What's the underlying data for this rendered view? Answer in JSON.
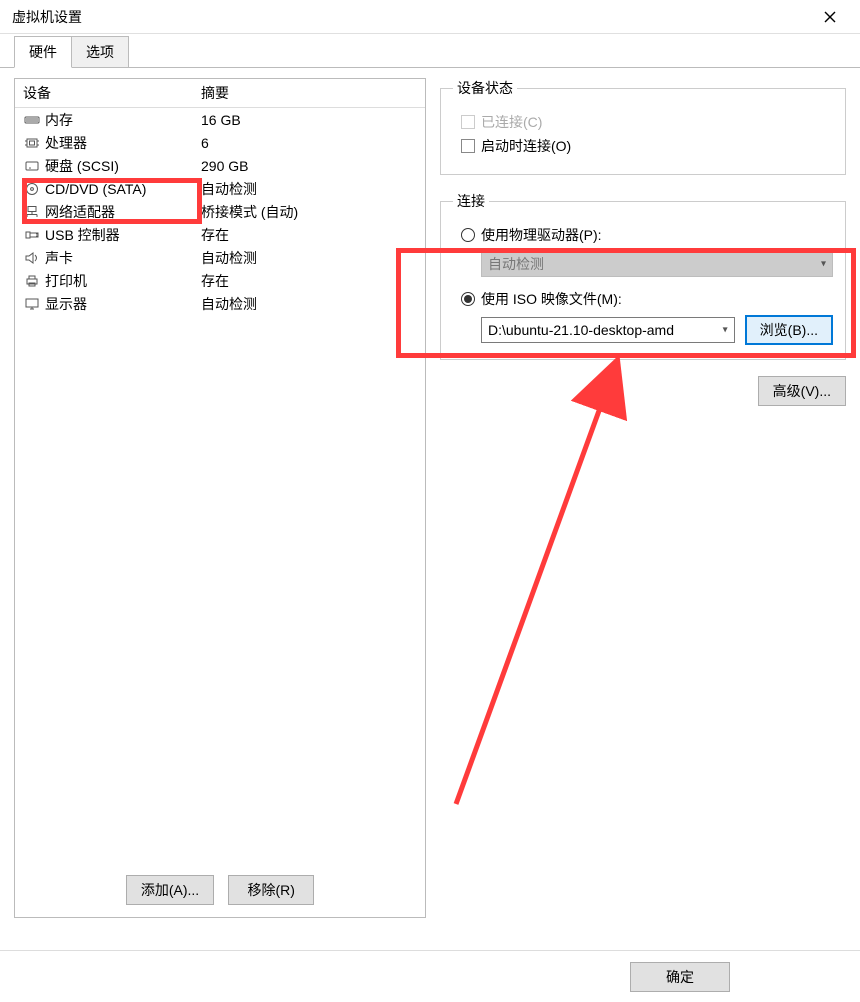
{
  "title": "虚拟机设置",
  "tabs": {
    "hardware": "硬件",
    "options": "选项"
  },
  "headers": {
    "device": "设备",
    "summary": "摘要"
  },
  "devices": [
    {
      "name": "内存",
      "summary": "16 GB",
      "icon": "memory"
    },
    {
      "name": "处理器",
      "summary": "6",
      "icon": "cpu"
    },
    {
      "name": "硬盘 (SCSI)",
      "summary": "290 GB",
      "icon": "disk"
    },
    {
      "name": "CD/DVD (SATA)",
      "summary": "自动检测",
      "icon": "cd"
    },
    {
      "name": "网络适配器",
      "summary": "桥接模式 (自动)",
      "icon": "net"
    },
    {
      "name": "USB 控制器",
      "summary": "存在",
      "icon": "usb"
    },
    {
      "name": "声卡",
      "summary": "自动检测",
      "icon": "sound"
    },
    {
      "name": "打印机",
      "summary": "存在",
      "icon": "printer"
    },
    {
      "name": "显示器",
      "summary": "自动检测",
      "icon": "display"
    }
  ],
  "left_buttons": {
    "add": "添加(A)...",
    "remove": "移除(R)"
  },
  "right": {
    "status_legend": "设备状态",
    "connected": "已连接(C)",
    "connect_at_poweron": "启动时连接(O)",
    "conn_legend": "连接",
    "use_physical": "使用物理驱动器(P):",
    "physical_combo": "自动检测",
    "use_iso": "使用 ISO 映像文件(M):",
    "iso_combo": "D:\\ubuntu-21.10-desktop-amd",
    "browse": "浏览(B)...",
    "advanced": "高级(V)..."
  },
  "footer": {
    "ok": "确定"
  }
}
